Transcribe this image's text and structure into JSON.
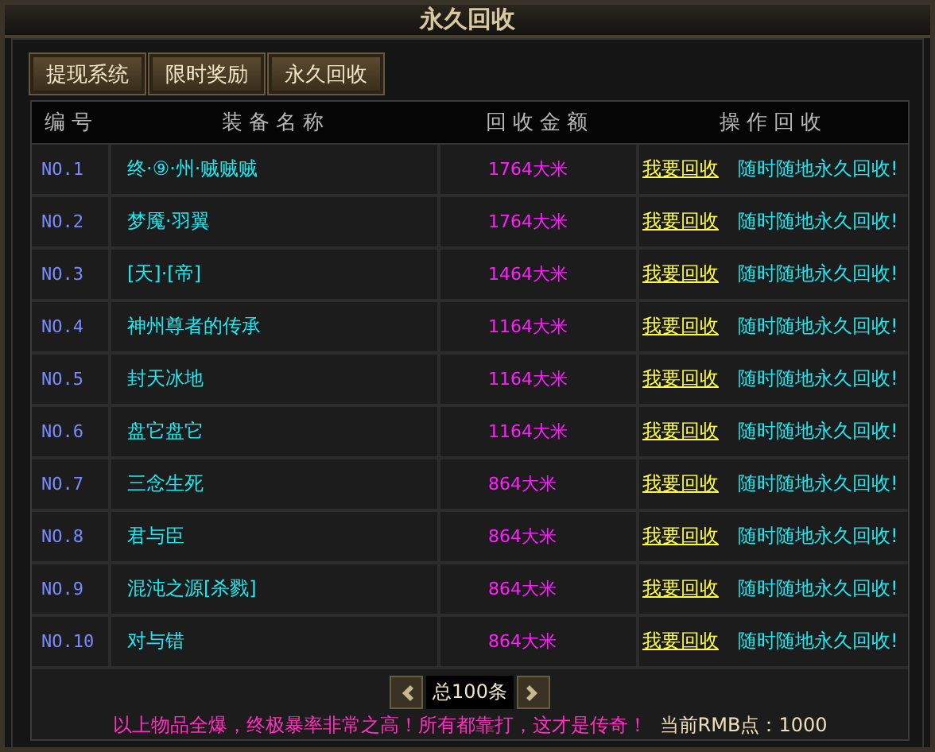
{
  "window": {
    "title": "永久回收"
  },
  "tabs": [
    {
      "label": "提现系统",
      "selected": false
    },
    {
      "label": "限时奖励",
      "selected": false
    },
    {
      "label": "永久回收",
      "selected": false
    }
  ],
  "table": {
    "columns": [
      "编号",
      "装备名称",
      "回收金额",
      "操作回收"
    ],
    "rows": [
      {
        "no": "NO.1",
        "name": "终·⑨·州·贼贼贼",
        "amount": "1764大米",
        "action": "我要回收",
        "note": "随时随地永久回收!"
      },
      {
        "no": "NO.2",
        "name": "梦魇·羽翼",
        "amount": "1764大米",
        "action": "我要回收",
        "note": "随时随地永久回收!"
      },
      {
        "no": "NO.3",
        "name": "[天]·[帝]",
        "amount": "1464大米",
        "action": "我要回收",
        "note": "随时随地永久回收!"
      },
      {
        "no": "NO.4",
        "name": "神州尊者的传承",
        "amount": "1164大米",
        "action": "我要回收",
        "note": "随时随地永久回收!"
      },
      {
        "no": "NO.5",
        "name": "封天冰地",
        "amount": "1164大米",
        "action": "我要回收",
        "note": "随时随地永久回收!"
      },
      {
        "no": "NO.6",
        "name": "盘它盘它",
        "amount": "1164大米",
        "action": "我要回收",
        "note": "随时随地永久回收!"
      },
      {
        "no": "NO.7",
        "name": "三念生死",
        "amount": "864大米",
        "action": "我要回收",
        "note": "随时随地永久回收!"
      },
      {
        "no": "NO.8",
        "name": "君与臣",
        "amount": "864大米",
        "action": "我要回收",
        "note": "随时随地永久回收!"
      },
      {
        "no": "NO.9",
        "name": "混沌之源[杀戮]",
        "amount": "864大米",
        "action": "我要回收",
        "note": "随时随地永久回收!"
      },
      {
        "no": "NO.10",
        "name": "对与错",
        "amount": "864大米",
        "action": "我要回收",
        "note": "随时随地永久回收!"
      }
    ]
  },
  "pager": {
    "total": "总100条"
  },
  "footer": {
    "notice": "以上物品全爆，终极暴率非常之高！所有都靠打，这才是传奇！",
    "balance": "当前RMB点：1000"
  }
}
